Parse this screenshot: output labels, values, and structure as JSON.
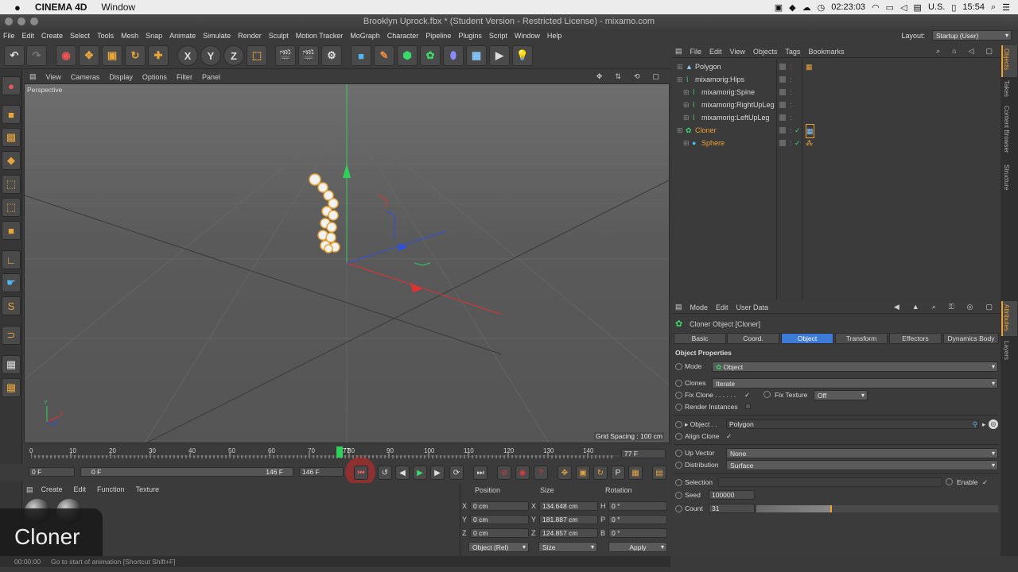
{
  "mac_menubar": {
    "app": "CINEMA 4D",
    "menu": "Window",
    "timer": "02:23:03",
    "input_source": "U.S.",
    "clock": "15:54"
  },
  "window": {
    "title": "Brooklyn Uprock.fbx * (Student Version - Restricted License) - mixamo.com"
  },
  "main_menu": [
    "File",
    "Edit",
    "Create",
    "Select",
    "Tools",
    "Mesh",
    "Snap",
    "Animate",
    "Simulate",
    "Render",
    "Sculpt",
    "Motion Tracker",
    "MoGraph",
    "Character",
    "Pipeline",
    "Plugins",
    "Script",
    "Window",
    "Help"
  ],
  "layout": {
    "label": "Layout:",
    "value": "Startup (User)"
  },
  "toolbar": {
    "x_label": "X",
    "y_label": "Y",
    "z_label": "Z"
  },
  "viewport": {
    "menu": [
      "View",
      "Cameras",
      "Display",
      "Options",
      "Filter",
      "Panel"
    ],
    "name": "Perspective",
    "grid_spacing": "Grid Spacing : 100 cm",
    "axis_x": "X",
    "axis_y": "Y",
    "axis_z": "Z"
  },
  "timeline": {
    "ticks": [
      "0",
      "10",
      "20",
      "30",
      "40",
      "50",
      "60",
      "70",
      "80",
      "90",
      "100",
      "110",
      "120",
      "130",
      "140"
    ],
    "current_marker": "77",
    "current_frame": "77 F",
    "start_frame": "0 F",
    "range_start": "0 F",
    "range_end": "146 F",
    "end_frame": "146 F"
  },
  "material_manager": {
    "menu": [
      "Create",
      "Edit",
      "Function",
      "Texture"
    ]
  },
  "overlay_label": "Cloner",
  "coordinates": {
    "headers": [
      "Position",
      "Size",
      "Rotation"
    ],
    "rows": [
      {
        "axis": "X",
        "pos": "0 cm",
        "saxis": "X",
        "size": "134.648 cm",
        "raxis": "H",
        "rot": "0 °"
      },
      {
        "axis": "Y",
        "pos": "0 cm",
        "saxis": "Y",
        "size": "181.887 cm",
        "raxis": "P",
        "rot": "0 °"
      },
      {
        "axis": "Z",
        "pos": "0 cm",
        "saxis": "Z",
        "size": "124.857 cm",
        "raxis": "B",
        "rot": "0 °"
      }
    ],
    "mode": "Object (Rel)",
    "size_mode": "Size",
    "apply": "Apply"
  },
  "status": {
    "time": "00:00:00",
    "message": "Go to start of animation [Shortcut Shift+F]"
  },
  "object_manager": {
    "menu": [
      "File",
      "Edit",
      "View",
      "Objects",
      "Tags",
      "Bookmarks"
    ],
    "objects": [
      {
        "name": "Polygon",
        "indent": 0,
        "color": "#d8d8d8"
      },
      {
        "name": "mixamorig:Hips",
        "indent": 0,
        "color": "#d8d8d8"
      },
      {
        "name": "mixamorig:Spine",
        "indent": 1,
        "color": "#d8d8d8"
      },
      {
        "name": "mixamorig:RightUpLeg",
        "indent": 1,
        "color": "#d8d8d8"
      },
      {
        "name": "mixamorig:LeftUpLeg",
        "indent": 1,
        "color": "#d8d8d8"
      },
      {
        "name": "Cloner",
        "indent": 0,
        "color": "#f0a030"
      },
      {
        "name": "Sphere",
        "indent": 1,
        "color": "#f0a030"
      }
    ]
  },
  "attributes": {
    "menu": [
      "Mode",
      "Edit",
      "User Data"
    ],
    "title": "Cloner Object [Cloner]",
    "tabs": [
      "Basic",
      "Coord.",
      "Object",
      "Transform",
      "Effectors",
      "Dynamics Body"
    ],
    "active_tab": "Object",
    "section": "Object Properties",
    "mode_label": "Mode",
    "mode_value": "Object",
    "clones_label": "Clones",
    "clones_value": "Iterate",
    "fix_clone_label": "Fix Clone . . . . . .",
    "fix_clone_check": "✓",
    "fix_texture_label": "Fix Texture",
    "fix_texture_value": "Off",
    "render_instances_label": "Render Instances",
    "object_label": "Object . .",
    "object_value": "Polygon",
    "align_clone_label": "Align Clone",
    "align_clone_check": "✓",
    "up_vector_label": "Up Vector",
    "up_vector_value": "None",
    "distribution_label": "Distribution",
    "distribution_value": "Surface",
    "selection_label": "Selection",
    "enable_label": "Enable",
    "enable_check": "✓",
    "seed_label": "Seed",
    "seed_value": "100000",
    "count_label": "Count",
    "count_value": "31",
    "count_fraction": 0.31
  },
  "side_tabs": [
    "Objects",
    "Takes",
    "Content Browser",
    "Structure"
  ],
  "side_tabs_lower": [
    "Attributes",
    "Layers"
  ],
  "colors": {
    "accent": "#3d7bd8",
    "highlight": "#f0a030",
    "record": "#e03b3b"
  }
}
